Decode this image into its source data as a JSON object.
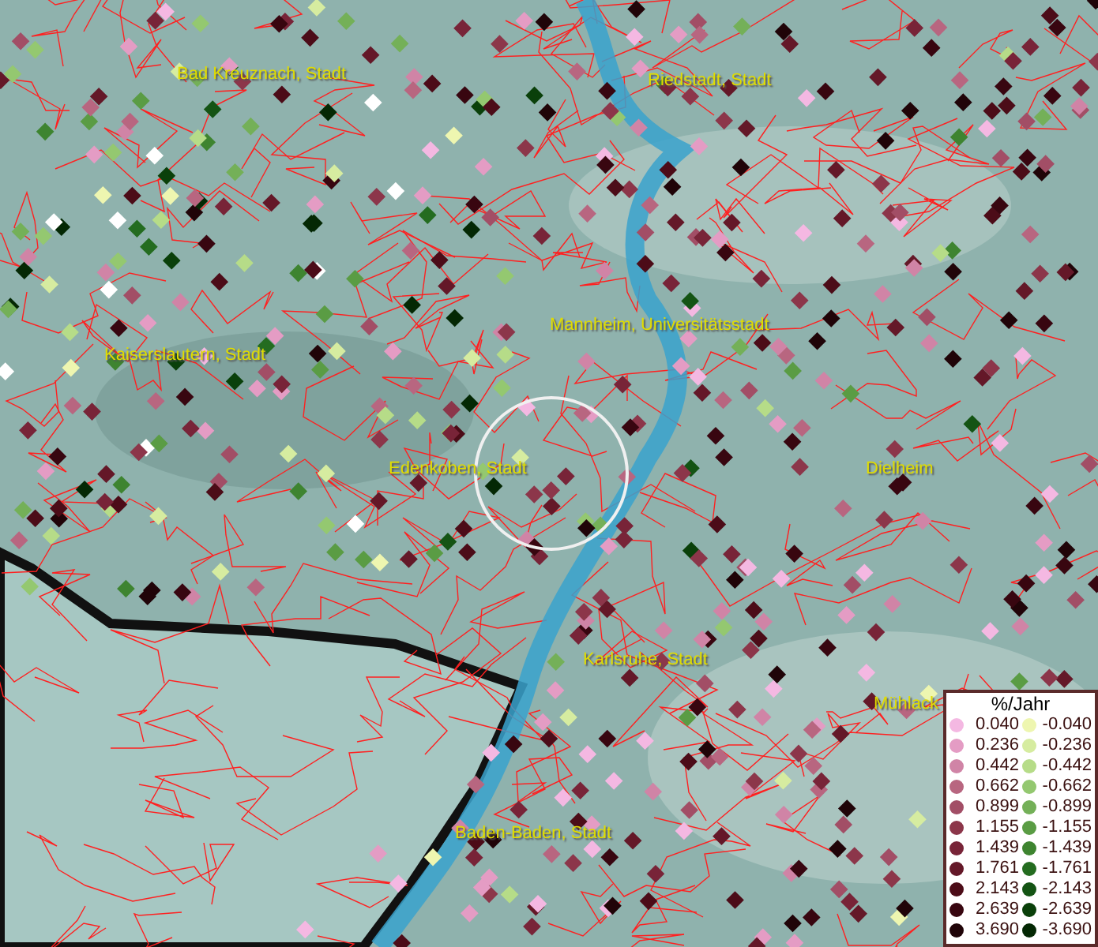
{
  "map": {
    "places": [
      {
        "name": "Bad Kreuznach, Stadt"
      },
      {
        "name": "Riedstadt, Stadt"
      },
      {
        "name": "Mannheim, Universitätsstadt"
      },
      {
        "name": "Kaiserslautern, Stadt"
      },
      {
        "name": "Edenkoben, Stadt"
      },
      {
        "name": "Dielheim"
      },
      {
        "name": "Karlsruhe, Stadt"
      },
      {
        "name": "Mühlack"
      },
      {
        "name": "Baden-Baden, Stadt"
      }
    ]
  },
  "legend": {
    "title": "%/Jahr",
    "columns": [
      [
        {
          "label": "0.040",
          "color": "#f4b8e2"
        },
        {
          "label": "0.236",
          "color": "#e49cc4"
        },
        {
          "label": "0.442",
          "color": "#d084a6"
        },
        {
          "label": "0.662",
          "color": "#b86680"
        },
        {
          "label": "0.899",
          "color": "#a24e66"
        },
        {
          "label": "1.155",
          "color": "#8c364a"
        },
        {
          "label": "1.439",
          "color": "#782438"
        },
        {
          "label": "1.761",
          "color": "#641828"
        },
        {
          "label": "2.143",
          "color": "#4c0c18"
        },
        {
          "label": "2.639",
          "color": "#380610"
        },
        {
          "label": "3.690",
          "color": "#200408"
        }
      ],
      [
        {
          "label": "-0.040",
          "color": "#eef6b0"
        },
        {
          "label": "-0.236",
          "color": "#d6eca0"
        },
        {
          "label": "-0.442",
          "color": "#b6dc88"
        },
        {
          "label": "-0.662",
          "color": "#94c870"
        },
        {
          "label": "-0.899",
          "color": "#74b058"
        },
        {
          "label": "-1.155",
          "color": "#5a9c44"
        },
        {
          "label": "-1.439",
          "color": "#3e8430"
        },
        {
          "label": "-1.761",
          "color": "#246c20"
        },
        {
          "label": "-2.143",
          "color": "#145414"
        },
        {
          "label": "-2.639",
          "color": "#0a400a"
        },
        {
          "label": "-3.690",
          "color": "#042804"
        }
      ]
    ]
  }
}
